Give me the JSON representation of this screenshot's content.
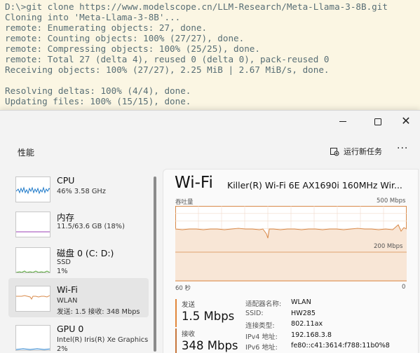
{
  "terminal": {
    "lines": [
      "D:\\>git clone https://www.modelscope.cn/LLM-Research/Meta-Llama-3-8B.git",
      "Cloning into 'Meta-Llama-3-8B'...",
      "remote: Enumerating objects: 27, done.",
      "remote: Counting objects: 100% (27/27), done.",
      "remote: Compressing objects: 100% (25/25), done.",
      "remote: Total 27 (delta 4), reused 0 (delta 0), pack-reused 0",
      "Receiving objects: 100% (27/27), 2.25 MiB | 2.67 MiB/s, done.",
      "",
      "Resolving deltas: 100% (4/4), done.",
      "Updating files: 100% (15/15), done."
    ]
  },
  "window": {
    "title_buttons": {
      "minimize_icon": "minimize-icon",
      "maximize_icon": "maximize-icon",
      "close_glyph": "✕"
    }
  },
  "header": {
    "page_title": "性能",
    "run_task_label": "运行新任务",
    "more_glyph": "···"
  },
  "sidebar": {
    "items": [
      {
        "title": "CPU",
        "sub1": "46%  3.58 GHz",
        "sub2": "",
        "color": "#1f7ac9"
      },
      {
        "title": "内存",
        "sub1": "11.5/63.6 GB (18%)",
        "sub2": "",
        "color": "#9b3fb5"
      },
      {
        "title": "磁盘 0 (C: D:)",
        "sub1": "SSD",
        "sub2": "1%",
        "color": "#4da12d"
      },
      {
        "title": "Wi-Fi",
        "sub1": "WLAN",
        "sub2": "发送: 1.5  接收: 348 Mbps",
        "color": "#d98a4a"
      },
      {
        "title": "GPU 0",
        "sub1": "Intel(R) Iris(R) Xe Graphics",
        "sub2": "2%",
        "color": "#1f7ac9"
      }
    ]
  },
  "main": {
    "title": "Wi-Fi",
    "adapter": "Killer(R) Wi-Fi 6E AX1690i 160MHz Wir...",
    "chart_label": "吞吐量",
    "chart_max": "500 Mbps",
    "chart_mid": "200 Mbps",
    "chart_x_left": "60 秒",
    "chart_x_right": "0",
    "send_label": "发送",
    "send_value": "1.5 Mbps",
    "recv_label": "接收",
    "recv_value": "348 Mbps",
    "props": [
      {
        "key": "适配器名称:",
        "value": "WLAN"
      },
      {
        "key": "SSID:",
        "value": "HW285"
      },
      {
        "key": "连接类型:",
        "value": "802.11ax"
      },
      {
        "key": "IPv4 地址:",
        "value": "192.168.3.8"
      },
      {
        "key": "IPv6 地址:",
        "value": "fe80::c41:3614:f788:11b0%8"
      }
    ],
    "accent": "#d98a4a"
  }
}
